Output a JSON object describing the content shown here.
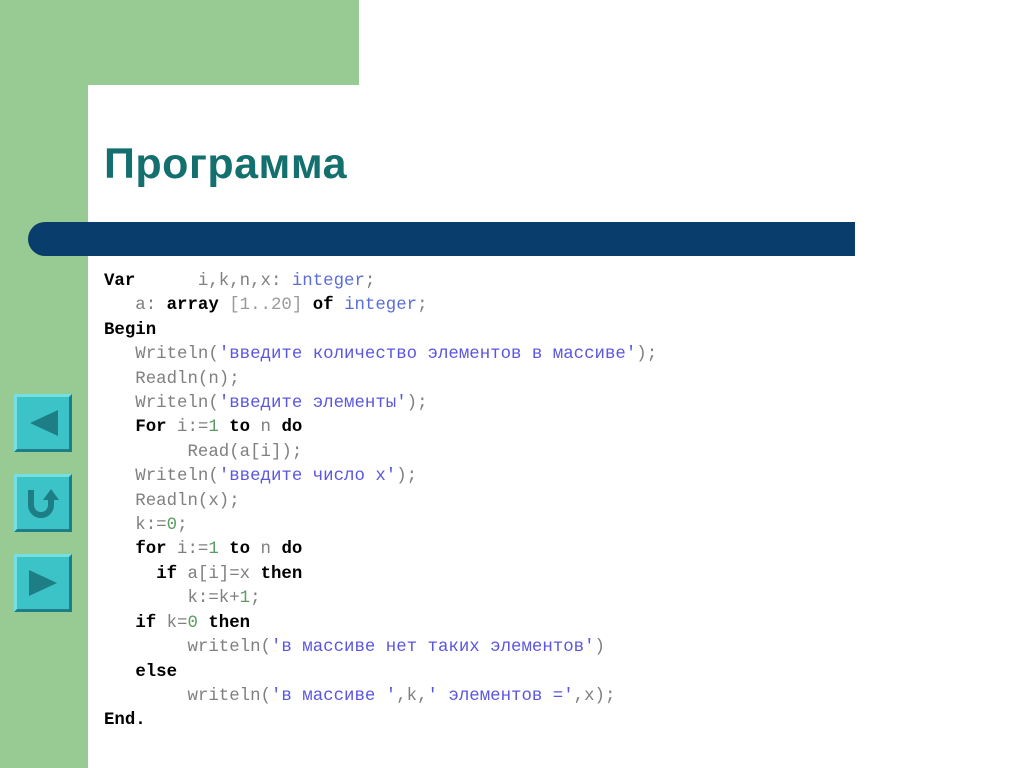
{
  "slide": {
    "title": "Программа",
    "title_color": "#13706e",
    "accent_green": "#98cb94",
    "accent_navy": "#093d6b",
    "button_fill": "#3bc3c8"
  },
  "nav": {
    "back_label": "back-arrow",
    "home_label": "return-arrow",
    "forward_label": "forward-arrow"
  },
  "code": {
    "lines": [
      {
        "id": "l01",
        "parts": [
          {
            "t": "Var",
            "c": "kw"
          },
          {
            "t": "      i,k,n,x: ",
            "c": "pl"
          },
          {
            "t": "integer",
            "c": "typ"
          },
          {
            "t": ";",
            "c": "pl"
          }
        ]
      },
      {
        "id": "l02",
        "parts": [
          {
            "t": "   a: ",
            "c": "pl"
          },
          {
            "t": "array",
            "c": "kw"
          },
          {
            "t": " ",
            "c": "pl"
          },
          {
            "t": "[1..20]",
            "c": "gry"
          },
          {
            "t": " ",
            "c": "pl"
          },
          {
            "t": "of",
            "c": "kw"
          },
          {
            "t": " ",
            "c": "pl"
          },
          {
            "t": "integer",
            "c": "typ"
          },
          {
            "t": ";",
            "c": "pl"
          }
        ]
      },
      {
        "id": "l03",
        "parts": [
          {
            "t": "Begin",
            "c": "kw"
          }
        ]
      },
      {
        "id": "l04",
        "parts": [
          {
            "t": "   Writeln(",
            "c": "pl"
          },
          {
            "t": "'введите количество элементов в массиве'",
            "c": "str"
          },
          {
            "t": ");",
            "c": "pl"
          }
        ]
      },
      {
        "id": "l05",
        "parts": [
          {
            "t": "   Readln(n);",
            "c": "pl"
          }
        ]
      },
      {
        "id": "l06",
        "parts": [
          {
            "t": "   Writeln(",
            "c": "pl"
          },
          {
            "t": "'введите элементы'",
            "c": "str"
          },
          {
            "t": ");",
            "c": "pl"
          }
        ]
      },
      {
        "id": "l07",
        "parts": [
          {
            "t": "   ",
            "c": "pl"
          },
          {
            "t": "For",
            "c": "kw"
          },
          {
            "t": " i:=",
            "c": "pl"
          },
          {
            "t": "1",
            "c": "num"
          },
          {
            "t": " ",
            "c": "pl"
          },
          {
            "t": "to",
            "c": "kw"
          },
          {
            "t": " n ",
            "c": "pl"
          },
          {
            "t": "do",
            "c": "kw"
          }
        ]
      },
      {
        "id": "l08",
        "parts": [
          {
            "t": "        Read(a[i]);",
            "c": "pl"
          }
        ]
      },
      {
        "id": "l09",
        "parts": [
          {
            "t": "   Writeln(",
            "c": "pl"
          },
          {
            "t": "'введите число x'",
            "c": "str"
          },
          {
            "t": ");",
            "c": "pl"
          }
        ]
      },
      {
        "id": "l10",
        "parts": [
          {
            "t": "   Readln(x);",
            "c": "pl"
          }
        ]
      },
      {
        "id": "l11",
        "parts": [
          {
            "t": "   k:=",
            "c": "pl"
          },
          {
            "t": "0",
            "c": "num"
          },
          {
            "t": ";",
            "c": "pl"
          }
        ]
      },
      {
        "id": "l12",
        "parts": [
          {
            "t": "   ",
            "c": "pl"
          },
          {
            "t": "for",
            "c": "kw"
          },
          {
            "t": " i:=",
            "c": "pl"
          },
          {
            "t": "1",
            "c": "num"
          },
          {
            "t": " ",
            "c": "pl"
          },
          {
            "t": "to",
            "c": "kw"
          },
          {
            "t": " n ",
            "c": "pl"
          },
          {
            "t": "do",
            "c": "kw"
          }
        ]
      },
      {
        "id": "l13",
        "parts": [
          {
            "t": "     ",
            "c": "pl"
          },
          {
            "t": "if",
            "c": "kw"
          },
          {
            "t": " a[i]=x ",
            "c": "pl"
          },
          {
            "t": "then",
            "c": "kw"
          }
        ]
      },
      {
        "id": "l14",
        "parts": [
          {
            "t": "        k:=k+",
            "c": "pl"
          },
          {
            "t": "1",
            "c": "num"
          },
          {
            "t": ";",
            "c": "pl"
          }
        ]
      },
      {
        "id": "l15",
        "parts": [
          {
            "t": "   ",
            "c": "pl"
          },
          {
            "t": "if",
            "c": "kw"
          },
          {
            "t": " k=",
            "c": "pl"
          },
          {
            "t": "0",
            "c": "num"
          },
          {
            "t": " ",
            "c": "pl"
          },
          {
            "t": "then",
            "c": "kw"
          }
        ]
      },
      {
        "id": "l16",
        "parts": [
          {
            "t": "        writeln(",
            "c": "pl"
          },
          {
            "t": "'в массиве нет таких элементов'",
            "c": "str"
          },
          {
            "t": ")",
            "c": "pl"
          }
        ]
      },
      {
        "id": "l17",
        "parts": [
          {
            "t": "   ",
            "c": "pl"
          },
          {
            "t": "else",
            "c": "kw"
          }
        ]
      },
      {
        "id": "l18",
        "parts": [
          {
            "t": "        writeln(",
            "c": "pl"
          },
          {
            "t": "'в массиве '",
            "c": "str"
          },
          {
            "t": ",k,",
            "c": "pl"
          },
          {
            "t": "' элементов ='",
            "c": "str"
          },
          {
            "t": ",x);",
            "c": "pl"
          }
        ]
      },
      {
        "id": "l19",
        "parts": [
          {
            "t": "End.",
            "c": "kw"
          }
        ]
      }
    ]
  }
}
